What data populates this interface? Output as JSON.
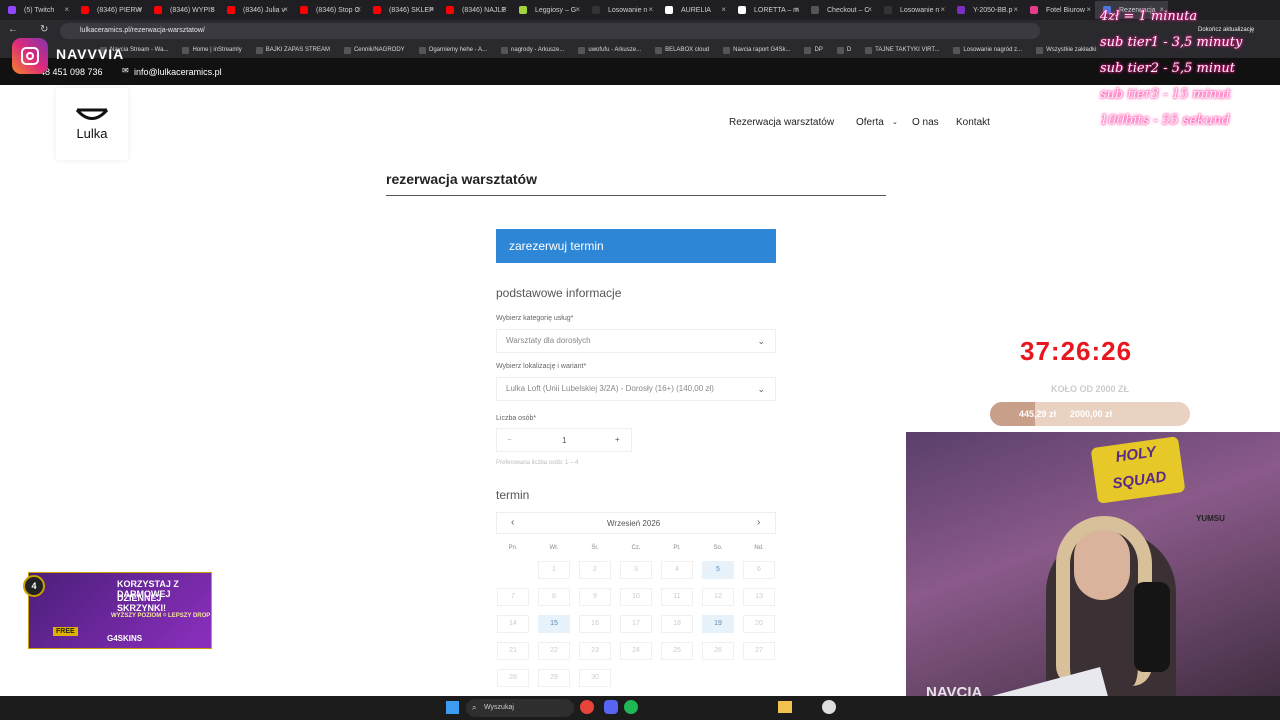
{
  "browser": {
    "tabs": [
      "(5) Twitch",
      "(8346) PIERW",
      "(8346) WYPIS",
      "(8346) Julia v",
      "(8346) Stop C",
      "(8346) SKLEP",
      "(8346) NAJLE",
      "Leggiosy – G",
      "Losowanie n",
      "AURELIA",
      "LORETTA – m",
      "Checkout – C",
      "Losowanie n",
      "Y-2050-BB.p",
      "Fotel Biurow",
      "Rezerwacja"
    ],
    "url": "lulkaceramics.pl/rezerwacja-warsztatow/",
    "update_label": "Dokończ aktualizację",
    "bookmarks": [
      "Navcia Stream - Wa...",
      "Home | inStreamly",
      "BAJKI ZAPAS STREAM",
      "Cennik/NAGRODY",
      "Ogarniemy hehe - A...",
      "nagrody - Arkusze...",
      "uwofufu - Arkusze...",
      "BELABOX cloud",
      "Navcia raport G4Sk...",
      "DP",
      "D",
      "TAJNE TAKTYKI VIRT...",
      "Losowanie nagród z...",
      "Wszystkie zakładki"
    ]
  },
  "site": {
    "phone": "48 451 098 736",
    "email": "info@lulkaceramics.pl",
    "logo_text": "Lulka",
    "nav": [
      "Rezerwacja warsztatów",
      "Oferta",
      "O nas",
      "Kontakt"
    ],
    "page_title": "rezerwacja warsztatów",
    "reserve_button": "zarezerwuj termin",
    "section_basic": "podstawowe informacje",
    "category_label": "Wybierz kategorię usług*",
    "category_value": "Warsztaty dla dorosłych",
    "location_label": "Wybierz lokalizację i wariant*",
    "location_value": "Lulka Loft (Unii Lubelskiej 3/2A) - Dorosły (16+) (140,00 zł)",
    "people_label": "Liczba osób*",
    "people_minus": "−",
    "people_value": "1",
    "people_plus": "+",
    "people_hint": "Preferowana liczba osób: 1 – 4",
    "section_term": "termin",
    "calendar_month": "Wrzesień 2026",
    "calendar_prev": "‹",
    "calendar_next": "›",
    "weekdays": [
      "Pn.",
      "Wt.",
      "Śr.",
      "Cz.",
      "Pt.",
      "So.",
      "Nd."
    ],
    "weeks": [
      [
        "",
        "1",
        "2",
        "3",
        "4",
        "5",
        "6"
      ],
      [
        "7",
        "8",
        "9",
        "10",
        "11",
        "12",
        "13"
      ],
      [
        "14",
        "15",
        "16",
        "17",
        "18",
        "19",
        "20"
      ],
      [
        "21",
        "22",
        "23",
        "24",
        "25",
        "26",
        "27"
      ],
      [
        "28",
        "29",
        "30",
        "",
        "",
        "",
        ""
      ]
    ],
    "available_days": [
      "5",
      "15",
      "19"
    ]
  },
  "overlay": {
    "channel": "NAVVVIA",
    "rates": [
      "4zł = 1 minuta",
      "sub tier1 - 3,5 minuty",
      "sub tier2 - 5,5 minut",
      "sub tier3 - 15 minut",
      "100bits - 55 sekund"
    ],
    "timer": "37:26:26",
    "goal_title": "KOŁO OD 2000 ZŁ",
    "goal_current": "445,29 zł",
    "goal_target": "2000,00 zł",
    "goal_fraction": 0.2226,
    "promo_badge": "4",
    "promo_line1": "KORZYSTAJ Z DARMOWEJ",
    "promo_line2": "DZIENNEJ SKRZYNKI!",
    "promo_line3": "WYŻSZY POZIOM = LEPSZY DROP",
    "promo_free": "FREE",
    "promo_brand": "G4SKINS",
    "cam_logo": "HOLY SQUAD",
    "cam_watermark": "NAVCIA",
    "cam_chair": "YUMSU"
  },
  "taskbar": {
    "search": "Wyszukaj"
  }
}
